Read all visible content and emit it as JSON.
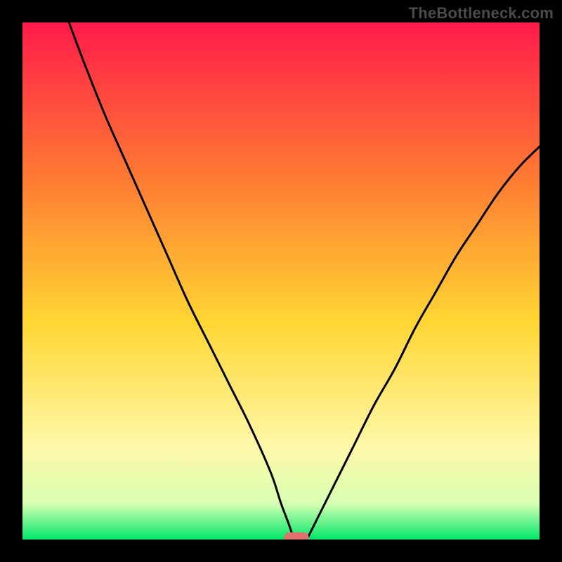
{
  "watermark": "TheBottleneck.com",
  "colors": {
    "frame": "#000000",
    "grad_top": "#ff1b4a",
    "grad_mid1": "#ff7a33",
    "grad_mid2": "#ffd633",
    "grad_low1": "#fff8a8",
    "grad_low2": "#d9ffb3",
    "grad_bottom": "#00e76a",
    "curve": "#000000",
    "marker_fill": "#e0726d",
    "marker_stroke": "#e0726d"
  },
  "chart_data": {
    "type": "line",
    "title": "",
    "xlabel": "",
    "ylabel": "",
    "xlim": [
      0,
      100
    ],
    "ylim": [
      0,
      100
    ],
    "notes": "V-shaped bottleneck curve on a red→green vertical gradient. Left branch reaches y≈100 near x≈9 and descends to y≈0 at x≈52. Right branch rises smoothly from x≈55 y≈0 to x≈100 y≈76. A small rounded marker sits on the x-axis at x≈53.",
    "series": [
      {
        "name": "left_branch",
        "x": [
          9,
          12,
          16,
          20,
          24,
          28,
          32,
          36,
          40,
          44,
          48,
          50,
          51.5,
          52.5
        ],
        "y": [
          100,
          92,
          82,
          73,
          64,
          55,
          46,
          38,
          30,
          22,
          13,
          7,
          3,
          0
        ]
      },
      {
        "name": "right_branch",
        "x": [
          55,
          57,
          60,
          64,
          68,
          72,
          76,
          80,
          84,
          88,
          92,
          96,
          100
        ],
        "y": [
          0,
          4,
          10,
          18,
          26,
          33,
          41,
          48,
          55,
          61,
          67,
          72,
          76
        ]
      }
    ],
    "marker": {
      "x": 53.0,
      "y": 0.0,
      "rx": 2.4,
      "ry": 1.4
    }
  }
}
